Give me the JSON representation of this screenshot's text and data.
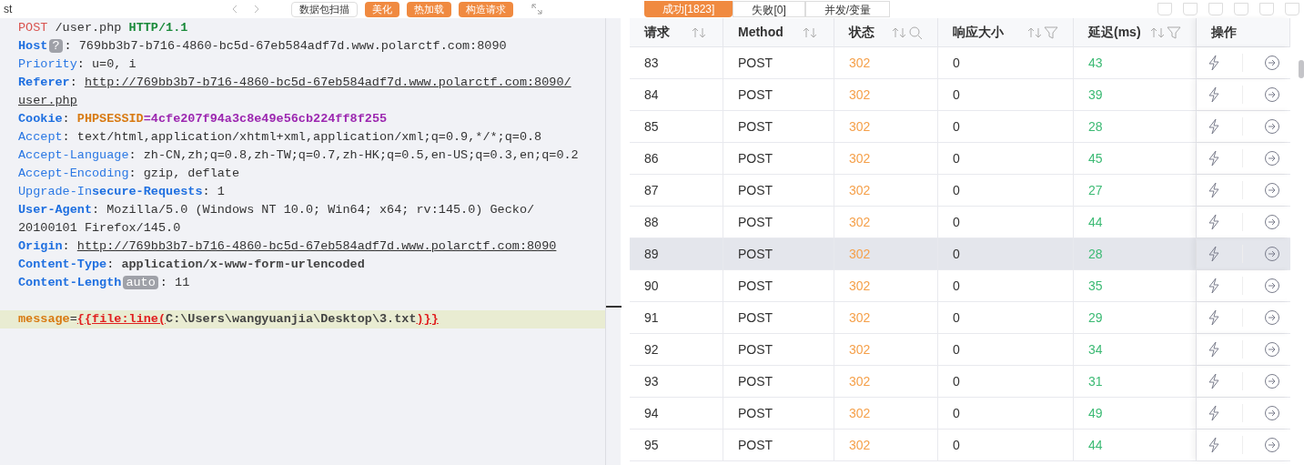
{
  "editor": {
    "title_fragment": "st",
    "buttons": [
      {
        "label": "数据包扫描",
        "kind": "plain"
      },
      {
        "label": "美化",
        "kind": "accent"
      },
      {
        "label": "热加载",
        "kind": "accent"
      },
      {
        "label": "构造请求",
        "kind": "accent"
      }
    ],
    "lines": [
      [
        {
          "text": "POST",
          "kind": "method"
        },
        {
          "text": " /user.php ",
          "kind": "value"
        },
        {
          "text": "HTTP/1.1",
          "kind": "version"
        }
      ],
      [
        {
          "text": "Host",
          "kind": "key"
        },
        {
          "text": "?",
          "kind": "badge"
        },
        {
          "text": ": 769bb3b7-b716-4860-bc5d-67eb584adf7d.www.polarctf.com:8090",
          "kind": "value"
        }
      ],
      [
        {
          "text": "Priority",
          "kind": "key-plain"
        },
        {
          "text": ": u=0, i",
          "kind": "value"
        }
      ],
      [
        {
          "text": "Referer",
          "kind": "key"
        },
        {
          "text": ": ",
          "kind": "value"
        },
        {
          "text": "http://769bb3b7-b716-4860-bc5d-67eb584adf7d.www.polarctf.com:8090/",
          "kind": "url"
        }
      ],
      [
        {
          "text": "user.php",
          "kind": "url"
        }
      ],
      [
        {
          "text": "Cookie",
          "kind": "key"
        },
        {
          "text": ": ",
          "kind": "value"
        },
        {
          "text": "PHPSESSID",
          "kind": "cookie-name"
        },
        {
          "text": "=4cfe207f94a3c8e49e56cb224ff8f255",
          "kind": "cookie-value"
        }
      ],
      [
        {
          "text": "Accept",
          "kind": "key-plain"
        },
        {
          "text": ": text/html,application/xhtml+xml,application/xml;q=0.9,*/*;q=0.8",
          "kind": "value"
        }
      ],
      [
        {
          "text": "Accept-Language",
          "kind": "key-plain"
        },
        {
          "text": ": zh-CN,zh;q=0.8,zh-TW;q=0.7,zh-HK;q=0.5,en-US;q=0.3,en;q=0.2",
          "kind": "value"
        }
      ],
      [
        {
          "text": "Accept-Encoding",
          "kind": "key-plain"
        },
        {
          "text": ": gzip, deflate",
          "kind": "value"
        }
      ],
      [
        {
          "text": "Upgrade-In",
          "kind": "key-plain"
        },
        {
          "text": "secure-Requests",
          "kind": "key"
        },
        {
          "text": ": 1",
          "kind": "value"
        }
      ],
      [
        {
          "text": "User-Agent",
          "kind": "key"
        },
        {
          "text": ": Mozilla/5.0 (Windows NT 10.0; Win64; x64; rv:145.0) Gecko/",
          "kind": "value"
        }
      ],
      [
        {
          "text": "20100101 Firefox/145.0",
          "kind": "value"
        }
      ],
      [
        {
          "text": "Origin",
          "kind": "key"
        },
        {
          "text": ": ",
          "kind": "value"
        },
        {
          "text": "http://769bb3b7-b716-4860-bc5d-67eb584adf7d.www.polarctf.com:8090",
          "kind": "url"
        }
      ],
      [
        {
          "text": "Content-Type",
          "kind": "key"
        },
        {
          "text": ": ",
          "kind": "value"
        },
        {
          "text": "application/x-www-form-urlencoded",
          "kind": "value-bold"
        }
      ],
      [
        {
          "text": "Content-Length",
          "kind": "key"
        },
        {
          "text": "auto",
          "kind": "badge"
        },
        {
          "text": ": 11",
          "kind": "value"
        }
      ]
    ],
    "body": [
      [
        {
          "text": "message",
          "kind": "body-key"
        },
        {
          "text": "=",
          "kind": "value"
        },
        {
          "text": "{{file:line(",
          "kind": "template"
        },
        {
          "text": "C:\\Users\\wangyuanjia\\Desktop\\3.txt",
          "kind": "value-bold"
        },
        {
          "text": ")}}",
          "kind": "template"
        }
      ]
    ]
  },
  "results": {
    "tabs": [
      {
        "label": "成功[1823]",
        "selected": true
      },
      {
        "label": "失败[0]",
        "selected": false
      },
      {
        "label": "并发/变量",
        "selected": false
      }
    ],
    "columns": [
      {
        "label": "请求",
        "sort": true,
        "search": false,
        "filter": false
      },
      {
        "label": "Method",
        "sort": true,
        "search": false,
        "filter": false
      },
      {
        "label": "状态",
        "sort": true,
        "search": true,
        "filter": false
      },
      {
        "label": "响应大小",
        "sort": true,
        "search": false,
        "filter": true
      },
      {
        "label": "延迟(ms)",
        "sort": true,
        "search": false,
        "filter": true
      },
      {
        "label": "操作",
        "sort": false,
        "search": false,
        "filter": false
      }
    ],
    "rows": [
      {
        "id": "83",
        "method": "POST",
        "status": "302",
        "size": "0",
        "delay": "43",
        "selected": false
      },
      {
        "id": "84",
        "method": "POST",
        "status": "302",
        "size": "0",
        "delay": "39",
        "selected": false
      },
      {
        "id": "85",
        "method": "POST",
        "status": "302",
        "size": "0",
        "delay": "28",
        "selected": false
      },
      {
        "id": "86",
        "method": "POST",
        "status": "302",
        "size": "0",
        "delay": "45",
        "selected": false
      },
      {
        "id": "87",
        "method": "POST",
        "status": "302",
        "size": "0",
        "delay": "27",
        "selected": false
      },
      {
        "id": "88",
        "method": "POST",
        "status": "302",
        "size": "0",
        "delay": "44",
        "selected": false
      },
      {
        "id": "89",
        "method": "POST",
        "status": "302",
        "size": "0",
        "delay": "28",
        "selected": true
      },
      {
        "id": "90",
        "method": "POST",
        "status": "302",
        "size": "0",
        "delay": "35",
        "selected": false
      },
      {
        "id": "91",
        "method": "POST",
        "status": "302",
        "size": "0",
        "delay": "29",
        "selected": false
      },
      {
        "id": "92",
        "method": "POST",
        "status": "302",
        "size": "0",
        "delay": "34",
        "selected": false
      },
      {
        "id": "93",
        "method": "POST",
        "status": "302",
        "size": "0",
        "delay": "31",
        "selected": false
      },
      {
        "id": "94",
        "method": "POST",
        "status": "302",
        "size": "0",
        "delay": "49",
        "selected": false
      },
      {
        "id": "95",
        "method": "POST",
        "status": "302",
        "size": "0",
        "delay": "44",
        "selected": false
      }
    ]
  }
}
